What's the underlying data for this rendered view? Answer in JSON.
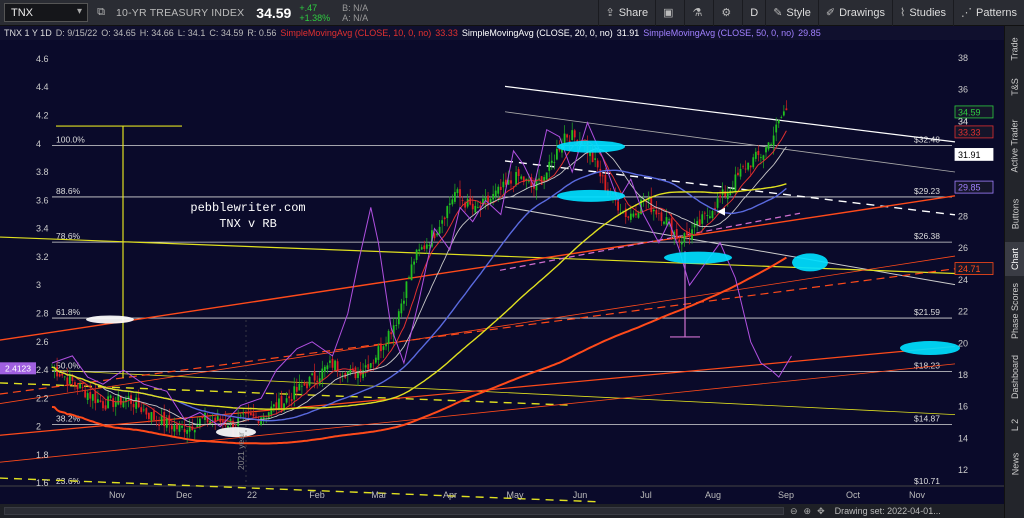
{
  "toolbar": {
    "symbol": "TNX",
    "name": "10-YR TREASURY INDEX",
    "price": "34.59",
    "change": "+.47",
    "change_pct": "+1.38%",
    "bid": "B: N/A",
    "ask": "A: N/A",
    "buttons": [
      {
        "label": "Share",
        "icon": "share-icon"
      },
      {
        "label": "",
        "icon": "screenshot-icon"
      },
      {
        "label": "",
        "icon": "flask-icon"
      },
      {
        "label": "",
        "icon": "gear-icon"
      },
      {
        "label": "D",
        "icon": ""
      },
      {
        "label": "Style",
        "icon": "style-icon"
      },
      {
        "label": "Drawings",
        "icon": "drawings-icon"
      },
      {
        "label": "Studies",
        "icon": "studies-icon"
      },
      {
        "label": "Patterns",
        "icon": "patterns-icon"
      }
    ]
  },
  "legend": {
    "symbol_info": "TNX 1 Y 1D",
    "d": "D: 9/15/22",
    "o": "O: 34.65",
    "h": "H: 34.66",
    "l": "L: 34.1",
    "c": "C: 34.59",
    "r": "R: 0.56",
    "sma10": "SimpleMovingAvg (CLOSE, 10, 0, no)",
    "sma10_val": "33.33",
    "sma20": "SimpleMovingAvg (CLOSE, 20, 0, no)",
    "sma20_val": "31.91",
    "sma50": "SimpleMovingAvg (CLOSE, 50, 0, no)",
    "sma50_val": "29.85"
  },
  "sidebar": {
    "tabs": [
      "Trade",
      "T&S",
      "Active Trader",
      "Buttons",
      "Chart",
      "Phase Scores",
      "Dashboard",
      "L 2",
      "News"
    ],
    "active": "Chart"
  },
  "footer": {
    "drawing_set": "Drawing set: 2022-04-01..."
  },
  "chart_data": {
    "type": "candlestick",
    "title": "",
    "annotation": "pebblewriter.com\nTNX v RB",
    "x_tick_labels": [
      "Nov",
      "Dec",
      "22",
      "Feb",
      "Mar",
      "Apr",
      "May",
      "Jun",
      "Jul",
      "Aug",
      "Sep",
      "Oct",
      "Nov"
    ],
    "vertical_label": "2021 year",
    "right_axis": {
      "ticks": [
        12,
        14,
        16,
        18,
        20,
        22,
        24,
        26,
        28,
        30,
        32,
        34,
        36,
        38
      ],
      "ylim": [
        11,
        39
      ]
    },
    "left_axis": {
      "ticks": [
        1.6,
        1.8,
        2.0,
        2.2,
        2.4,
        2.6,
        2.8,
        3.0,
        3.2,
        3.4,
        3.6,
        3.8,
        4.0,
        4.2,
        4.4,
        4.6
      ],
      "ylim": [
        1.58,
        4.72
      ]
    },
    "left_price_flag": "2.4123",
    "right_tags": [
      {
        "label": "34",
        "color": "#cccccc"
      },
      {
        "label": "34.59",
        "color": "#2ecc40"
      },
      {
        "label": "33.33",
        "color": "#e03030"
      },
      {
        "label": "31.91",
        "color": "#ffffff"
      },
      {
        "label": "29.85",
        "color": "#a080ff"
      },
      {
        "label": "24.71",
        "color": "#ff4a1a"
      }
    ],
    "fib_levels": [
      {
        "pct": "100.0%",
        "value": "$32.48",
        "y": 32.48
      },
      {
        "pct": "88.6%",
        "value": "$29.23",
        "y": 29.23
      },
      {
        "pct": "78.6%",
        "value": "$26.38",
        "y": 26.38
      },
      {
        "pct": "61.8%",
        "value": "$21.59",
        "y": 21.59
      },
      {
        "pct": "50.0%",
        "value": "$18.23",
        "y": 18.23
      },
      {
        "pct": "38.2%",
        "value": "$14.87",
        "y": 14.87
      },
      {
        "pct": "23.6%",
        "value": "$10.71",
        "y": 10.71
      }
    ],
    "price_anchors": [
      [
        0,
        18.5
      ],
      [
        10,
        17.3
      ],
      [
        20,
        16.2
      ],
      [
        30,
        16.5
      ],
      [
        40,
        15.3
      ],
      [
        50,
        14.6
      ],
      [
        60,
        15.2
      ],
      [
        70,
        15.0
      ],
      [
        80,
        15.3
      ],
      [
        90,
        16.2
      ],
      [
        100,
        17.5
      ],
      [
        110,
        18.7
      ],
      [
        118,
        18.0
      ],
      [
        126,
        19.0
      ],
      [
        135,
        21.5
      ],
      [
        142,
        25.3
      ],
      [
        150,
        27.0
      ],
      [
        158,
        29.5
      ],
      [
        166,
        28.3
      ],
      [
        175,
        29.5
      ],
      [
        183,
        30.5
      ],
      [
        189,
        29.8
      ],
      [
        195,
        31.0
      ],
      [
        201,
        33.2
      ],
      [
        208,
        32.8
      ],
      [
        214,
        31.0
      ],
      [
        218,
        29.5
      ],
      [
        226,
        28.0
      ],
      [
        232,
        29.0
      ],
      [
        240,
        28.0
      ],
      [
        246,
        26.5
      ],
      [
        253,
        27.3
      ],
      [
        259,
        28.6
      ],
      [
        266,
        29.8
      ],
      [
        272,
        31.2
      ],
      [
        279,
        32.0
      ],
      [
        284,
        33.5
      ],
      [
        287,
        34.6
      ]
    ],
    "series": [
      {
        "name": "SimpleMovingAvg (CLOSE, 10, 0, no)",
        "color": "#e03030",
        "last": 33.33
      },
      {
        "name": "SimpleMovingAvg (CLOSE, 20, 0, no)",
        "color": "#ffffff",
        "last": 31.91
      },
      {
        "name": "SimpleMovingAvg (CLOSE, 50, 0, no)",
        "color": "#a080ff",
        "last": 29.85
      },
      {
        "name": "",
        "color": "#e0e020",
        "last": 29.9
      },
      {
        "name": "",
        "color": "#ff4a1a",
        "last": 24.71
      }
    ],
    "rb_overlay": [
      [
        0,
        2.45
      ],
      [
        8,
        2.5
      ],
      [
        14,
        2.35
      ],
      [
        20,
        2.3
      ],
      [
        28,
        2.4
      ],
      [
        36,
        2.3
      ],
      [
        45,
        2.25
      ],
      [
        52,
        2.05
      ],
      [
        58,
        2.1
      ],
      [
        66,
        2.0
      ],
      [
        74,
        2.15
      ],
      [
        82,
        2.2
      ],
      [
        88,
        2.4
      ],
      [
        96,
        2.55
      ],
      [
        102,
        2.6
      ],
      [
        110,
        2.5
      ],
      [
        116,
        2.8
      ],
      [
        120,
        3.15
      ],
      [
        125,
        3.55
      ],
      [
        128,
        3.3
      ],
      [
        133,
        2.7
      ],
      [
        138,
        2.45
      ],
      [
        144,
        2.9
      ],
      [
        150,
        3.4
      ],
      [
        156,
        3.25
      ],
      [
        160,
        3.55
      ],
      [
        165,
        3.45
      ],
      [
        170,
        3.6
      ],
      [
        176,
        3.5
      ],
      [
        181,
        3.95
      ],
      [
        185,
        3.85
      ],
      [
        189,
        3.7
      ],
      [
        194,
        4.1
      ],
      [
        199,
        4.05
      ],
      [
        204,
        3.8
      ],
      [
        210,
        4.15
      ],
      [
        216,
        3.9
      ],
      [
        222,
        3.6
      ],
      [
        227,
        3.75
      ],
      [
        232,
        3.5
      ],
      [
        238,
        3.3
      ],
      [
        242,
        3.45
      ],
      [
        246,
        3.25
      ],
      [
        250,
        3.0
      ],
      [
        256,
        3.15
      ],
      [
        262,
        3.3
      ],
      [
        268,
        3.05
      ],
      [
        274,
        2.6
      ],
      [
        278,
        2.45
      ],
      [
        282,
        2.4
      ],
      [
        285,
        2.35
      ],
      [
        290,
        2.5
      ]
    ],
    "grid": false,
    "legend_position": "top"
  }
}
